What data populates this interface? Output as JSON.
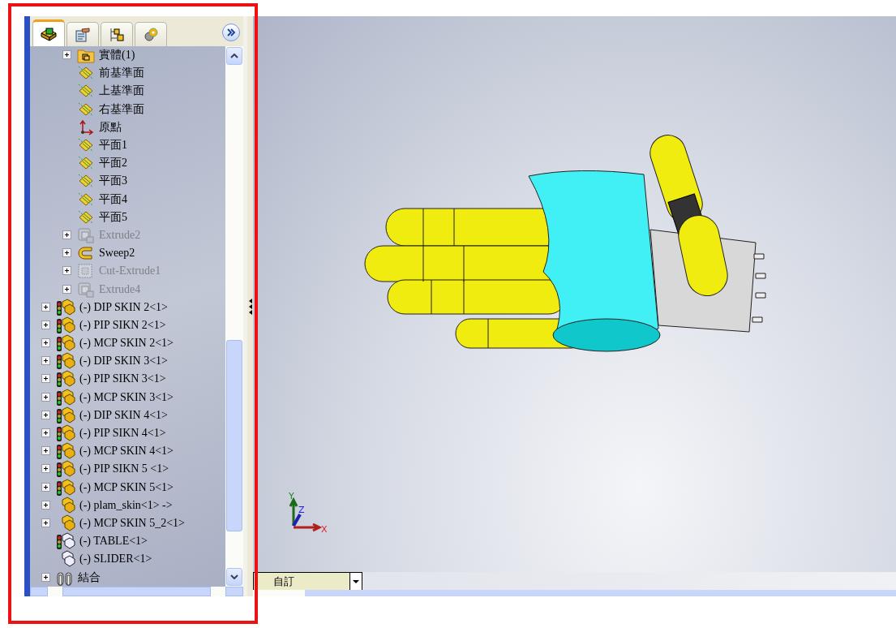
{
  "panel": {
    "tabs": [
      {
        "kind": "part",
        "selected": true
      },
      {
        "kind": "property",
        "selected": false
      },
      {
        "kind": "config",
        "selected": false
      },
      {
        "kind": "appearance",
        "selected": false
      }
    ],
    "tree": [
      {
        "children": [
          {
            "label": "實體(1)",
            "kind": "folder",
            "expandable": true,
            "suppressed": false
          },
          {
            "label": "前基準面",
            "kind": "plane",
            "expandable": false,
            "suppressed": false
          },
          {
            "label": "上基準面",
            "kind": "plane",
            "expandable": false,
            "suppressed": false
          },
          {
            "label": "右基準面",
            "kind": "plane",
            "expandable": false,
            "suppressed": false
          },
          {
            "label": "原點",
            "kind": "origin",
            "expandable": false,
            "suppressed": false
          },
          {
            "label": "平面1",
            "kind": "plane",
            "expandable": false,
            "suppressed": false
          },
          {
            "label": "平面2",
            "kind": "plane",
            "expandable": false,
            "suppressed": false
          },
          {
            "label": "平面3",
            "kind": "plane",
            "expandable": false,
            "suppressed": false
          },
          {
            "label": "平面4",
            "kind": "plane",
            "expandable": false,
            "suppressed": false
          },
          {
            "label": "平面5",
            "kind": "plane",
            "expandable": false,
            "suppressed": false
          },
          {
            "label": "Extrude2",
            "kind": "extrude",
            "expandable": true,
            "suppressed": true
          },
          {
            "label": "Sweep2",
            "kind": "sweep",
            "expandable": true,
            "suppressed": false
          },
          {
            "label": "Cut-Extrude1",
            "kind": "cut",
            "expandable": true,
            "suppressed": true
          },
          {
            "label": "Extrude4",
            "kind": "extrude",
            "expandable": true,
            "suppressed": true
          }
        ]
      },
      {
        "label": "(-) DIP SKIN 2<1>",
        "kind": "component-rebuild",
        "expandable": true,
        "suppressed": false
      },
      {
        "label": "(-) PIP SIKN 2<1>",
        "kind": "component-rebuild",
        "expandable": true,
        "suppressed": false
      },
      {
        "label": "(-) MCP SKIN 2<1>",
        "kind": "component-rebuild",
        "expandable": true,
        "suppressed": false
      },
      {
        "label": "(-) DIP SKIN 3<1>",
        "kind": "component-rebuild",
        "expandable": true,
        "suppressed": false
      },
      {
        "label": "(-) PIP SIKN 3<1>",
        "kind": "component-rebuild",
        "expandable": true,
        "suppressed": false
      },
      {
        "label": "(-) MCP SKIN 3<1>",
        "kind": "component-rebuild",
        "expandable": true,
        "suppressed": false
      },
      {
        "label": "(-) DIP SKIN 4<1>",
        "kind": "component-rebuild",
        "expandable": true,
        "suppressed": false
      },
      {
        "label": "(-) PIP SIKN 4<1>",
        "kind": "component-rebuild",
        "expandable": true,
        "suppressed": false
      },
      {
        "label": "(-) MCP SKIN 4<1>",
        "kind": "component-rebuild",
        "expandable": true,
        "suppressed": false
      },
      {
        "label": "(-) PIP SIKN 5 <1>",
        "kind": "component-rebuild",
        "expandable": true,
        "suppressed": false
      },
      {
        "label": "(-) MCP SKIN 5<1>",
        "kind": "component-rebuild",
        "expandable": true,
        "suppressed": false
      },
      {
        "label": "(-) plam_skin<1> ->",
        "kind": "component",
        "expandable": true,
        "suppressed": false
      },
      {
        "label": "(-) MCP SKIN 5_2<1>",
        "kind": "component",
        "expandable": true,
        "suppressed": false
      },
      {
        "label": "(-) TABLE<1>",
        "kind": "outline-rebuild",
        "expandable": false,
        "suppressed": false
      },
      {
        "label": "(-) SLIDER<1>",
        "kind": "outline",
        "expandable": false,
        "suppressed": false
      },
      {
        "label": "結合",
        "kind": "mates",
        "expandable": true,
        "suppressed": false
      }
    ]
  },
  "viewport": {
    "triad": {
      "x": "X",
      "y": "Y",
      "z": "Z"
    },
    "view_bar": {
      "dropdown": "自訂"
    }
  }
}
